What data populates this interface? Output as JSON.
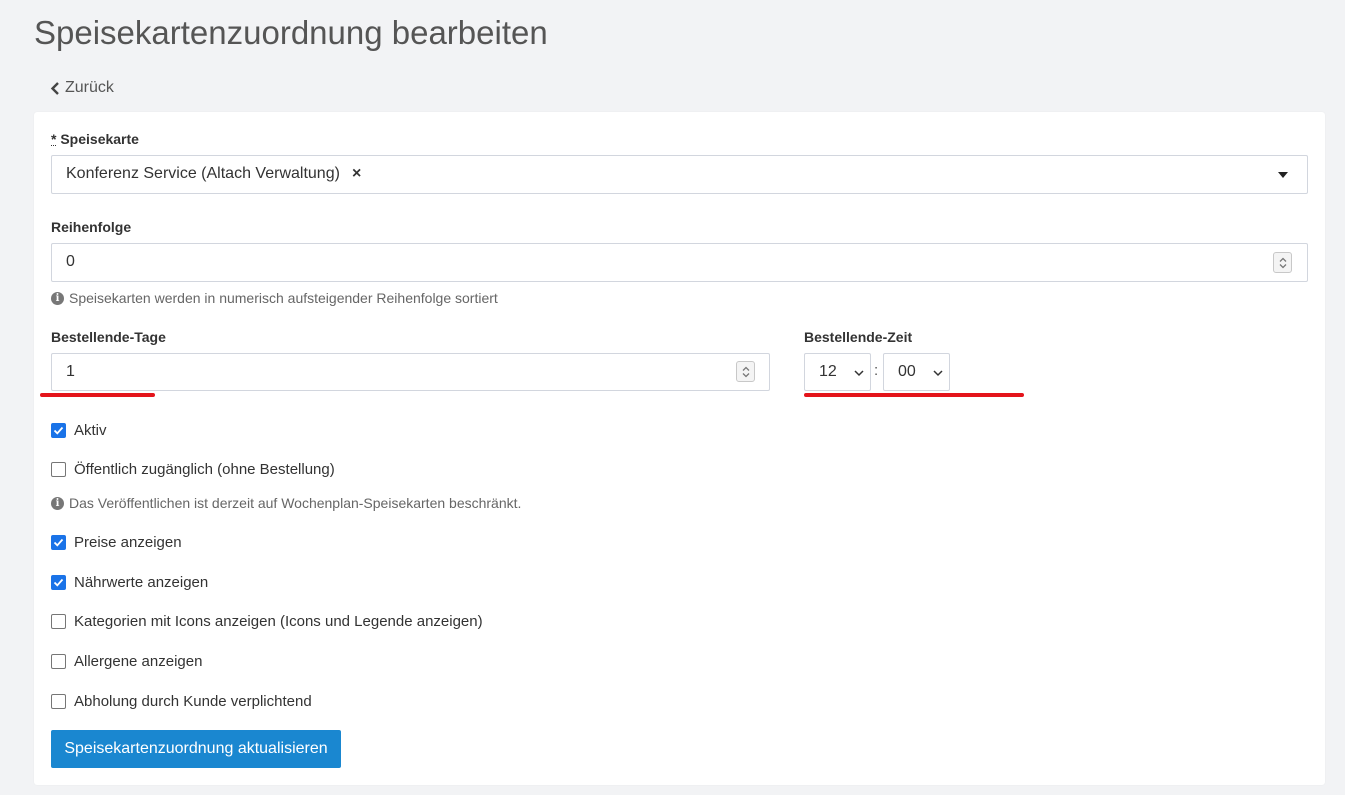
{
  "page": {
    "title": "Speisekartenzuordnung bearbeiten",
    "back_label": "Zurück"
  },
  "form": {
    "speisekarte": {
      "required_mark": "*",
      "label": "Speisekarte",
      "value": "Konferenz Service (Altach Verwaltung)",
      "clear_glyph": "×"
    },
    "reihenfolge": {
      "label": "Reihenfolge",
      "value": "0",
      "help": "Speisekarten werden in numerisch aufsteigender Reihenfolge sortiert"
    },
    "bestellende_tage": {
      "label": "Bestellende-Tage",
      "value": "1"
    },
    "bestellende_zeit": {
      "label": "Bestellende-Zeit",
      "hour": "12",
      "separator": ":",
      "minute": "00"
    },
    "checkboxes": [
      {
        "label": "Aktiv",
        "checked": true
      },
      {
        "label": "Öffentlich zugänglich (ohne Bestellung)",
        "checked": false
      },
      {
        "label": "Preise anzeigen",
        "checked": true
      },
      {
        "label": "Nährwerte anzeigen",
        "checked": true
      },
      {
        "label": "Kategorien mit Icons anzeigen (Icons und Legende anzeigen)",
        "checked": false
      },
      {
        "label": "Allergene anzeigen",
        "checked": false
      },
      {
        "label": "Abholung durch Kunde verplichtend",
        "checked": false
      }
    ],
    "publish_help": "Das Veröffentlichen ist derzeit auf Wochenplan-Speisekarten beschränkt.",
    "submit_label": "Speisekartenzuordnung aktualisieren"
  },
  "icons": {
    "back": "chevron-left-icon",
    "dropdown": "caret-down-icon",
    "info": "info-icon",
    "spinner": "spinner-arrows-icon",
    "check": "checkmark-icon"
  },
  "colors": {
    "primary_button": "#1a87d0",
    "checkbox_checked": "#1a73e8",
    "annotation_underline": "#e4141b",
    "background": "#f2f3f5"
  }
}
